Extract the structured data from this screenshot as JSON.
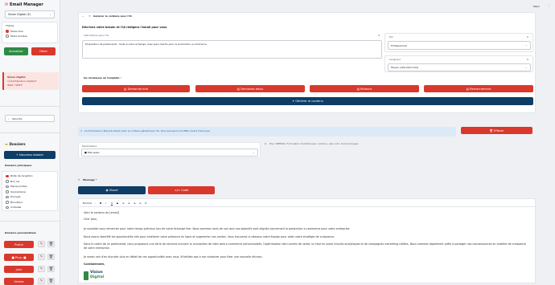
{
  "sidebar": {
    "title": "Email Manager",
    "brand_select": "Vision Digital (E)",
    "theme_label": "Thème",
    "theme_options": [
      "Mode Clair",
      "Mode Sombre"
    ],
    "update_button": "Actualiser",
    "save_button": "Gérer",
    "account_notice_title": "Vision Digital",
    "account_notice_line1": "contact@vision-digital.fr",
    "account_notice_line2": "IMAP / SMTP",
    "security_label": "Sécurité",
    "folders_title": "Dossiers",
    "new_folder_button": "+ Nouveau dossier",
    "main_folders_title": "Dossiers principaux",
    "main_folders": [
      "Boîte de réception",
      "Non lus",
      "Pièces jointes",
      "Quarantaine",
      "Envoyés",
      "Brouillons",
      "Corbeille"
    ],
    "custom_folders_title": "Dossiers personnalisés",
    "custom_folders": [
      "Pushh",
      "■ Plug. ■",
      "Junk",
      "Ventes"
    ]
  },
  "topbar": {
    "menu_label": "Menu"
  },
  "ai": {
    "section_title": "Générer le contenu avec l'IA",
    "describe_label": "Décrivez votre besoin et l'IA rédigera l'email pour vous",
    "instructions_label": "Instructions pour l'IA",
    "instructions_value": "Proposition de partenariat - Suite à votre échange. Avec Jean-martin pour la production e-commerce",
    "tone_label": "Ton",
    "tone_value": "Professionnel",
    "length_label": "Longueur",
    "length_value": "Moyen (100-200 mots)",
    "template_title": "Ou choisissez un template :",
    "templates": [
      "Demande info",
      "Demande devis",
      "Relance",
      "Remerciement"
    ],
    "generate_button": "Générer le contenu"
  },
  "banner": {
    "text": "Le formulaire a été pré-rempli avec le contenu généré par l'IA. Vous pouvez le modifier avant d'envoyer.",
    "clear_button": "Effacer"
  },
  "recipient": {
    "label": "Destinataire",
    "value": "■ FNA webs",
    "hint": "Pour KEEPKO: Formulaire d'enfant-avec contenu, pbx, info, formal images"
  },
  "message": {
    "label": "Message *",
    "visual_tab": "Visuel",
    "code_tab": "Code",
    "toolbar_format": "Normal",
    "toolbar_buttons": [
      "B",
      "I",
      "U",
      "S",
      "≡",
      "≡",
      "≡",
      "≡",
      "⊘"
    ],
    "body_lines": [
      "Voici le contenu de [email]",
      "Cher Jean,",
      "Je souhaite vous remercier pour notre temps précieux lors de notre échange hier. Nous sommes ravis de voir que nos objectifs sont alignés concernant la production e-commerce pour votre entreprise.",
      "Nous avons identifié les opportunités clés pour améliorer votre présence en ligne et augmenter vos ventes. Vous trouverez ci-dessous notre équipe pour aider votre stratégie de croissance.",
      "Dans le cadre de ce partenariat, nous proposons une série de services incluant la conception de sites web e-commerce personnalisés, l'optimisation des tunnels de vente, la mise en place d'outils analytiques et de campagnes marketing ciblées. Nous sommes également prêts à partager nos connaissances en matière de croissance de votre entreprise.",
      "Je serais ravi d'en discuter plus en détail de ces opportunités avec vous. N'hésitez pas à me contacter pour fixer une nouvelle réunion.",
      "Cordialement,"
    ],
    "signature_logo_line1": "Vision",
    "signature_logo_line2": "Digital"
  }
}
